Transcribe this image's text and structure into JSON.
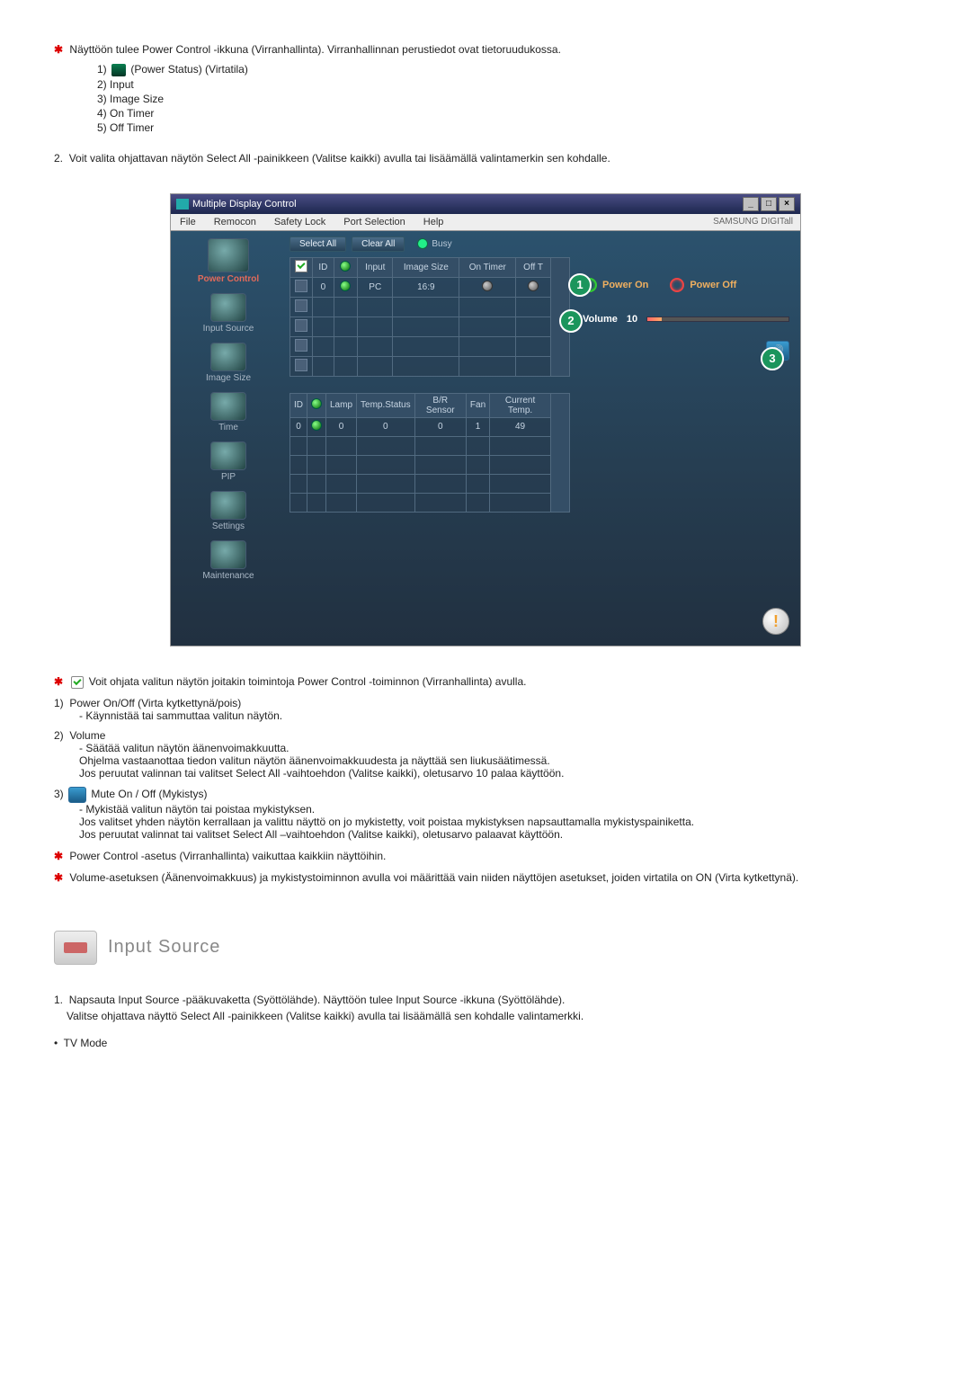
{
  "intro": {
    "line1": "Näyttöön tulee Power Control -ikkuna (Virranhallinta). Virranhallinnan perustiedot ovat tietoruudukossa.",
    "item1": "(Power Status) (Virtatila)",
    "item2": "Input",
    "item3": "Image Size",
    "item4": "On Timer",
    "item5": "Off Timer",
    "line2": "Voit valita ohjattavan näytön Select All -painikkeen (Valitse kaikki) avulla tai lisäämällä valintamerkin sen kohdalle."
  },
  "app": {
    "title": "Multiple Display Control",
    "menu": {
      "m1": "File",
      "m2": "Remocon",
      "m3": "Safety Lock",
      "m4": "Port Selection",
      "m5": "Help",
      "brand": "SAMSUNG DIGITall"
    },
    "sidebar": {
      "powerControl": "Power Control",
      "inputSource": "Input Source",
      "imageSize": "Image Size",
      "time": "Time",
      "pip": "PIP",
      "settings": "Settings",
      "maintenance": "Maintenance"
    },
    "controls": {
      "selectAll": "Select All",
      "clearAll": "Clear All",
      "busy": "Busy"
    },
    "table1": {
      "h_id": "ID",
      "h_input": "Input",
      "h_imgsize": "Image Size",
      "h_onTimer": "On Timer",
      "h_offTimer": "Off T",
      "row": {
        "id": "0",
        "input": "PC",
        "imgsize": "16:9"
      }
    },
    "table2": {
      "h_id": "ID",
      "h_lamp": "Lamp",
      "h_temp": "Temp.Status",
      "h_br": "B/R Sensor",
      "h_fan": "Fan",
      "h_ct": "Current Temp.",
      "row": {
        "id": "0",
        "lamp": "0",
        "temp": "0",
        "br": "0",
        "fan": "1",
        "ct": "49"
      }
    },
    "right": {
      "powerOn": "Power On",
      "powerOff": "Power Off",
      "volumeLabel": "Volume",
      "volumeValue": "10"
    },
    "callouts": {
      "c1": "1",
      "c2": "2",
      "c3": "3"
    }
  },
  "below": {
    "p1": "Voit ohjata valitun näytön joitakin toimintoja Power Control -toiminnon (Virranhallinta) avulla.",
    "i1_title": "Power On/Off (Virta kytkettynä/pois)",
    "i1_l1": "Käynnistää tai sammuttaa valitun näytön.",
    "i2_title": "Volume",
    "i2_l1": "Säätää valitun näytön äänenvoimakkuutta.",
    "i2_l2": "Ohjelma vastaanottaa tiedon valitun näytön äänenvoimakkuudesta ja näyttää sen liukusäätimessä.",
    "i2_l3": "Jos peruutat valinnan tai valitset Select All -vaihtoehdon (Valitse kaikki), oletusarvo 10 palaa käyttöön.",
    "i3_title": "Mute On / Off (Mykistys)",
    "i3_l1": "Mykistää valitun näytön tai poistaa mykistyksen.",
    "i3_l2": "Jos valitset yhden näytön kerrallaan ja valittu näyttö on jo mykistetty, voit poistaa mykistyksen napsauttamalla mykistyspainiketta.",
    "i3_l3": "Jos peruutat valinnat tai valitset Select All –vaihtoehdon (Valitse kaikki), oletusarvo palaavat käyttöön.",
    "note1": "Power Control -asetus (Virranhallinta) vaikuttaa kaikkiin näyttöihin.",
    "note2": "Volume-asetuksen (Äänenvoimakkuus) ja mykistystoiminnon avulla voi määrittää vain niiden näyttöjen asetukset, joiden virtatila on ON (Virta kytkettynä)."
  },
  "inputSource": {
    "title": "Input Source",
    "step1": "Napsauta Input Source -pääkuvaketta (Syöttölähde). Näyttöön tulee Input Source -ikkuna (Syöttölähde).",
    "step1b": "Valitse ohjattava näyttö Select All -painikkeen (Valitse kaikki) avulla tai lisäämällä sen kohdalle valintamerkki.",
    "tv": "TV Mode"
  },
  "labels": {
    "n1": "1)",
    "n2": "2)",
    "n3": "3)",
    "n4": "4)",
    "n5": "5)",
    "two": "2.",
    "b1": "1)",
    "b2": "2)",
    "b3": "3)",
    "one": "1.",
    "bullet": "•"
  }
}
